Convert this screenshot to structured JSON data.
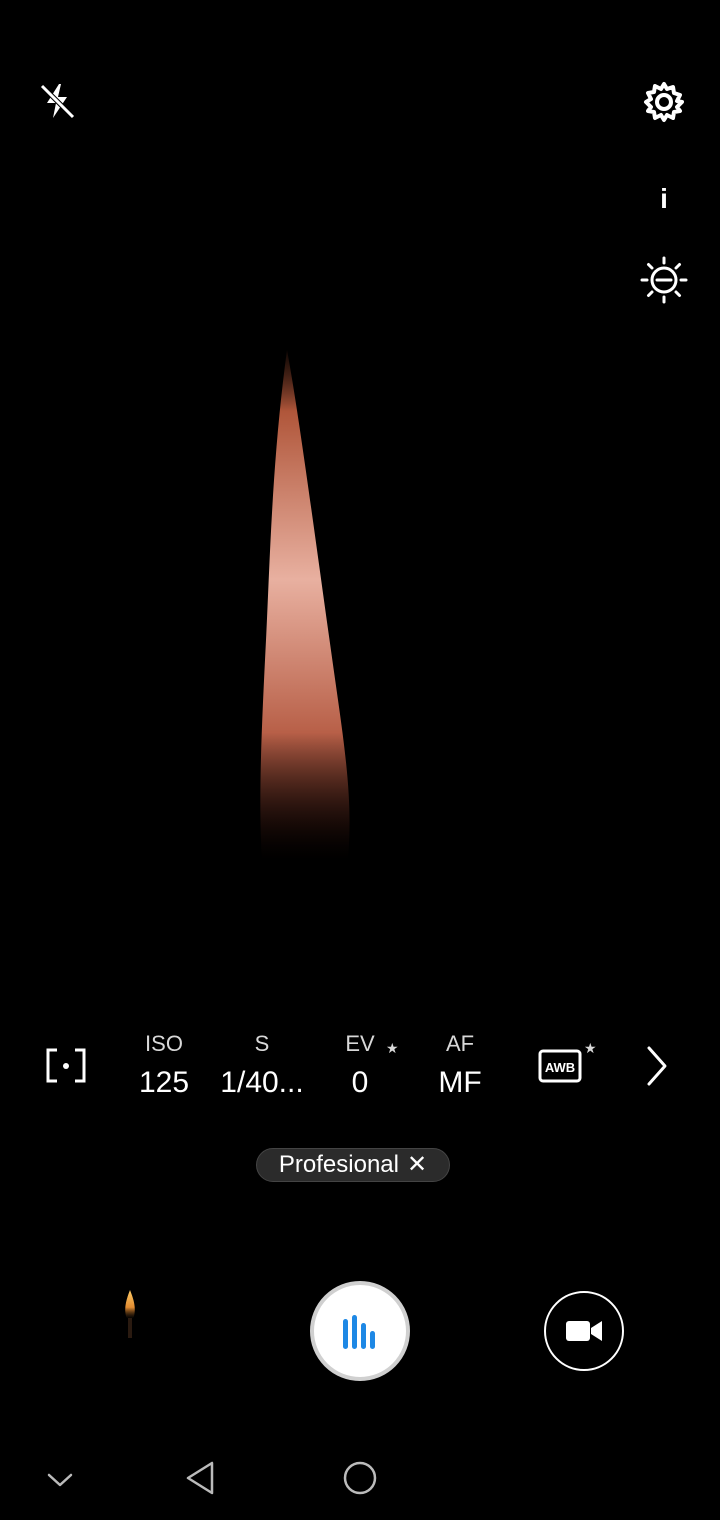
{
  "top_bar": {
    "flash_icon": "flash-off-icon",
    "settings_icon": "gear-icon",
    "info_label": "i",
    "exposure_icon": "brightness-minus-icon"
  },
  "pro_controls": {
    "metering_icon": "metering-icon",
    "iso": {
      "label": "ISO",
      "value": "125"
    },
    "shutter": {
      "label": "S",
      "value": "1/40..."
    },
    "ev": {
      "label": "EV",
      "value": "0",
      "star": "★"
    },
    "af": {
      "label": "AF",
      "value": "MF"
    },
    "awb": {
      "label": "AWB",
      "star": "★"
    },
    "next_icon": "chevron-right-icon"
  },
  "mode_chip": {
    "label": "Profesional",
    "close": "✕"
  },
  "capture": {
    "shutter_icon": "pro-shutter-icon",
    "video_icon": "video-camera-icon",
    "accent_color": "#1e88e5"
  },
  "navbar": {
    "hide_icon": "chevron-down-icon",
    "back_icon": "back-triangle-icon",
    "home_icon": "home-circle-icon"
  }
}
